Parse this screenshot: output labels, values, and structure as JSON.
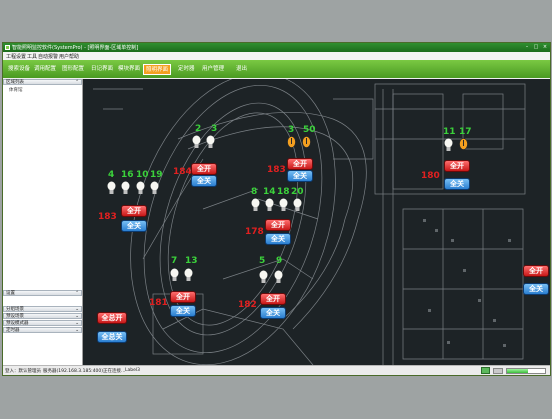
{
  "window": {
    "title": "智能照明监控软件(SystemPro) - [照明界面-区域单控制]",
    "controls": [
      "–",
      "□",
      "×"
    ]
  },
  "menu": {
    "items": [
      "工程",
      "设置",
      "工具",
      "自动报警",
      "用户",
      "帮助"
    ]
  },
  "toolbar": {
    "items": [
      "搜索设备",
      "调用配置",
      "图形配置",
      "日记界面",
      "模块界面",
      "照明界面",
      "定时器",
      "用户管理",
      "退出"
    ],
    "active_index": 5
  },
  "left_panel": {
    "section_top": "区域列表",
    "item": "体育馆",
    "section_mid": "设置",
    "sections_bottom": [
      "分组场景",
      "预设场景",
      "预设模式器",
      "定时器"
    ]
  },
  "canvas": {
    "groups": [
      {
        "labels": [
          "2",
          "3"
        ],
        "code": "",
        "on": "全开",
        "off": "全关"
      },
      {
        "labels": [
          "3",
          "50"
        ],
        "code": "183",
        "on": "全开",
        "off": "全关"
      },
      {
        "labels": [
          "11",
          "17"
        ],
        "code": "180",
        "on": "全开",
        "off": "全关"
      },
      {
        "labels": [
          "4",
          "16",
          "10",
          "19"
        ],
        "code": "183",
        "on": "全开",
        "off": "全关"
      },
      {
        "labels": [
          "8",
          "14",
          "18",
          "20"
        ],
        "code": "178",
        "on": "全开",
        "off": "全关"
      },
      {
        "labels": [
          "7",
          "13"
        ],
        "code": "181",
        "on": "全开",
        "off": "全关"
      },
      {
        "labels": [
          "5",
          "9"
        ],
        "code": "182",
        "on": "全开",
        "off": "全关"
      },
      {
        "labels": [],
        "code": "",
        "on": "全开",
        "off": "全关"
      },
      {
        "labels": [],
        "code": "",
        "on": "全总开",
        "off": "全总关"
      }
    ],
    "extra_code": "184"
  },
  "statusbar": {
    "user": "登入：默认管理员",
    "server": "服务器(192.168.3.185:400)正在连接...",
    "label": "Label3"
  },
  "colors": {
    "title_bar": "#1c6b1c",
    "toolbar": "#4a9a22",
    "active_tab": "#f4a020",
    "canvas_bg": "#1d2326",
    "number_green": "#3bd13b",
    "number_red": "#e02020"
  }
}
